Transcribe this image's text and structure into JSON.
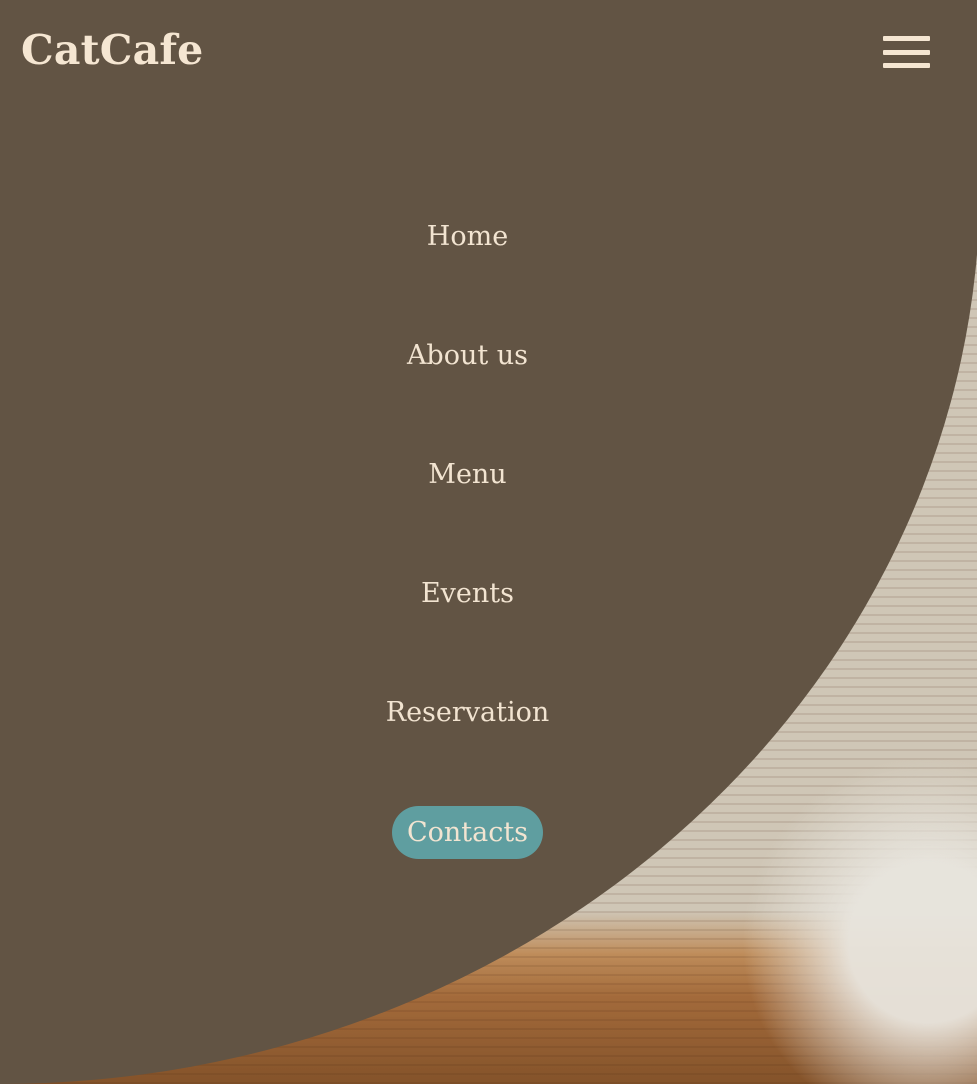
{
  "header": {
    "brand": "CatCafe",
    "menu_icon": "hamburger-icon"
  },
  "nav": {
    "items": [
      {
        "label": "Home"
      },
      {
        "label": "About us"
      },
      {
        "label": "Menu"
      },
      {
        "label": "Events"
      },
      {
        "label": "Reservation"
      },
      {
        "label": "Contacts",
        "active": true
      }
    ]
  },
  "colors": {
    "overlay": "#625444",
    "text": "#F2E4D1",
    "accent": "#5F9EA0"
  }
}
